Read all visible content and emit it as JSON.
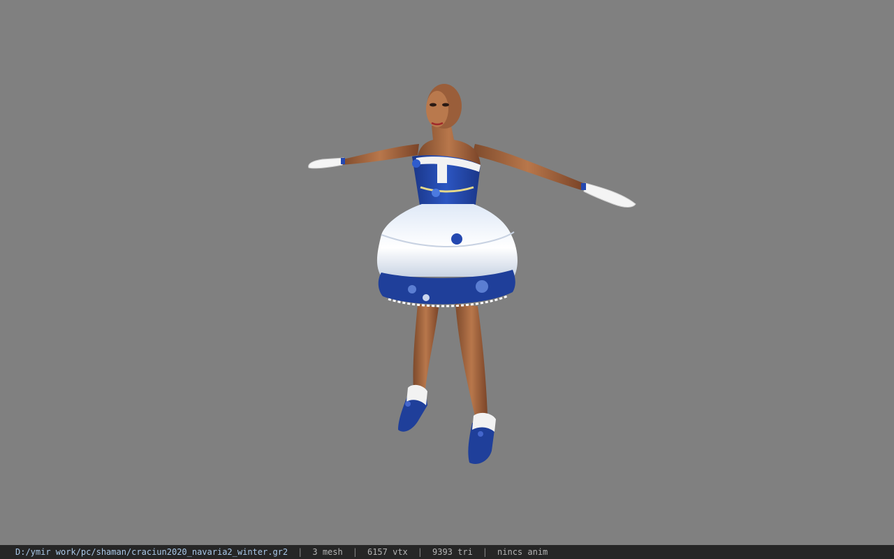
{
  "status": {
    "file_path": "D:/ymir work/pc/shaman/craciun2020_navaria2_winter.gr2",
    "separator": "|",
    "mesh": "3 mesh",
    "vertices": "6157 vtx",
    "triangles": "9393 tri",
    "animation": "nincs anim"
  },
  "colors": {
    "background": "#808080",
    "status_bar": "#262626",
    "dress_blue": "#1f3f9a",
    "dress_white": "#eef3fa",
    "skin": "#a0653f"
  }
}
